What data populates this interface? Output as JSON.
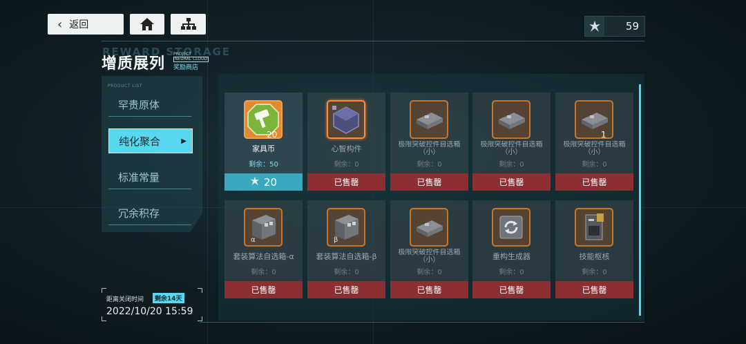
{
  "nav": {
    "back_label": "返回"
  },
  "currency": {
    "value": "59"
  },
  "header": {
    "watermark": "REWARD STORAGE",
    "title": "增质展列",
    "project_line1": "PROJECT",
    "project_line2": "NEURAL CLOUD",
    "shop_label": "奖励商店"
  },
  "sidebar": {
    "caption": "PRODUCT LIST",
    "items": [
      {
        "label": "罕贵原体"
      },
      {
        "label": "纯化聚合"
      },
      {
        "label": "标准常量"
      },
      {
        "label": "冗余积存"
      }
    ]
  },
  "close_info": {
    "label": "距离关闭时间",
    "remain": "剩余14天",
    "date": "2022/10/20 15:59"
  },
  "items": [
    {
      "name": "家具币",
      "qty": "20",
      "remain": "剩余：50",
      "price": "20",
      "status": "",
      "icon": "furniture-coin-icon"
    },
    {
      "name": "心智构件",
      "qty": "",
      "remain": "剩余：0",
      "status": "已售罄",
      "icon": "mind-component-icon"
    },
    {
      "name": "极限突破控件自选箱（小）",
      "qty": "",
      "remain": "剩余：0",
      "status": "已售罄",
      "icon": "selector-box-icon"
    },
    {
      "name": "极限突破控件自选箱（小）",
      "qty": "",
      "remain": "剩余：0",
      "status": "已售罄",
      "icon": "selector-box-icon"
    },
    {
      "name": "极限突破控件自选箱（小）",
      "qty": "1",
      "remain": "剩余：0",
      "status": "已售罄",
      "icon": "selector-box-icon"
    },
    {
      "name": "套装算法自选箱-α",
      "qty": "",
      "tag": "α",
      "remain": "剩余：0",
      "status": "已售罄",
      "icon": "algorithm-box-icon"
    },
    {
      "name": "套装算法自选箱-β",
      "qty": "",
      "tag": "β",
      "remain": "剩余：0",
      "status": "已售罄",
      "icon": "algorithm-box-icon"
    },
    {
      "name": "极限突破控件自选箱（小）",
      "qty": "",
      "remain": "剩余：0",
      "status": "已售罄",
      "icon": "selector-box-icon"
    },
    {
      "name": "重构生成器",
      "qty": "",
      "remain": "剩余：0",
      "status": "已售罄",
      "icon": "rebuild-generator-icon"
    },
    {
      "name": "技能枢核",
      "qty": "",
      "remain": "剩余：0",
      "status": "已售罄",
      "icon": "skill-core-icon"
    }
  ]
}
